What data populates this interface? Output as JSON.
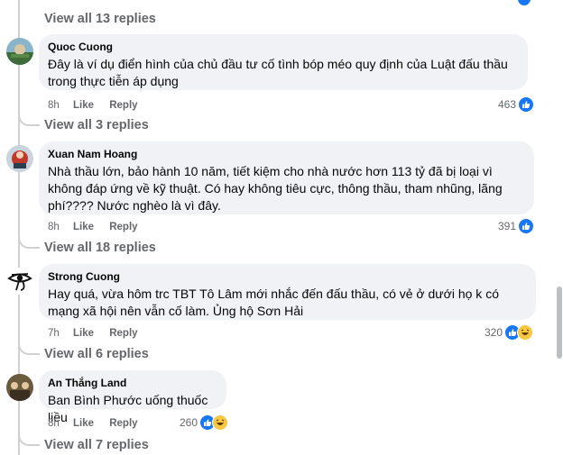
{
  "threads": [
    {
      "view_replies": "View all 13 replies"
    },
    {
      "view_replies": "View all 3 replies"
    },
    {
      "view_replies": "View all 18 replies"
    },
    {
      "view_replies": "View all 6 replies"
    },
    {
      "view_replies": "View all 7 replies"
    }
  ],
  "comments": [
    {
      "author": "Quoc Cuong",
      "text": "Đây là ví dụ điển hình của chủ đầu tư cố tình bóp méo quy định của Luật đấu thầu trong thực tiễn áp dụng",
      "time": "8h",
      "like": "Like",
      "reply": "Reply",
      "reaction_count": "463",
      "reactions": [
        "like-icon"
      ]
    },
    {
      "author": "Xuan Nam Hoang",
      "text": "Nhà thầu lớn, bảo hành 10 năm, tiết kiệm cho nhà nước hơn 113 tỷ đã bị loại vì không đáp ứng về kỹ thuật. Có hay không tiêu cực, thông thầu, tham nhũng, lãng phí???? Nước nghèo là vì đây.",
      "time": "8h",
      "like": "Like",
      "reply": "Reply",
      "reaction_count": "391",
      "reactions": [
        "like-icon"
      ]
    },
    {
      "author": "Strong Cuong",
      "text": "Hay quá, vừa hôm trc TBT Tô Lâm mới nhắc đến đấu thầu, có vẻ ở dưới họ k có mạng xã hội nên vẫn cố làm. Ủng hộ Sơn Hải",
      "time": "7h",
      "like": "Like",
      "reply": "Reply",
      "reaction_count": "320",
      "reactions": [
        "like-icon",
        "haha-icon"
      ]
    },
    {
      "author": "An Thắng Land",
      "text": "Ban Bình Phước uống thuốc liều",
      "time": "8h",
      "like": "Like",
      "reply": "Reply",
      "reaction_count": "260",
      "reactions": [
        "like-icon",
        "haha-icon"
      ]
    }
  ],
  "colors": {
    "accent": "#1877f2",
    "bubble": "#f0f2f5",
    "muted": "#65676b",
    "haha": "#f7c843"
  }
}
